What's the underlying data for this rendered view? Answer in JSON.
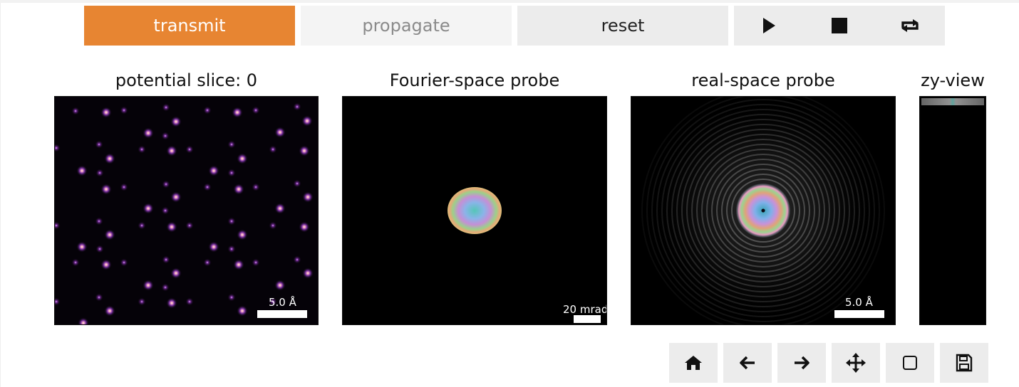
{
  "controls": {
    "transmit_label": "transmit",
    "propagate_label": "propagate",
    "reset_label": "reset",
    "player_icons": [
      "play-icon",
      "stop-icon",
      "loop-icon"
    ]
  },
  "panels": {
    "potential": {
      "title": "potential slice: 0",
      "scalebar": "5.0 Å"
    },
    "fourier": {
      "title": "Fourier-space probe",
      "scalebar": "20 mrad"
    },
    "realspace": {
      "title": "real-space probe",
      "scalebar": "5.0 Å"
    },
    "zy": {
      "title": "zy-view"
    }
  },
  "toolbar": {
    "icons": [
      "home-icon",
      "back-arrow-icon",
      "forward-arrow-icon",
      "pan-icon",
      "zoom-rect-icon",
      "save-icon"
    ]
  },
  "colors": {
    "accent": "#e78532",
    "button_bg": "#ececec",
    "button_disabled_bg": "#f4f4f4",
    "plot_bg": "#000000",
    "atom_core": "#ffe9b0",
    "atom_glow": "#7a2ca0"
  }
}
